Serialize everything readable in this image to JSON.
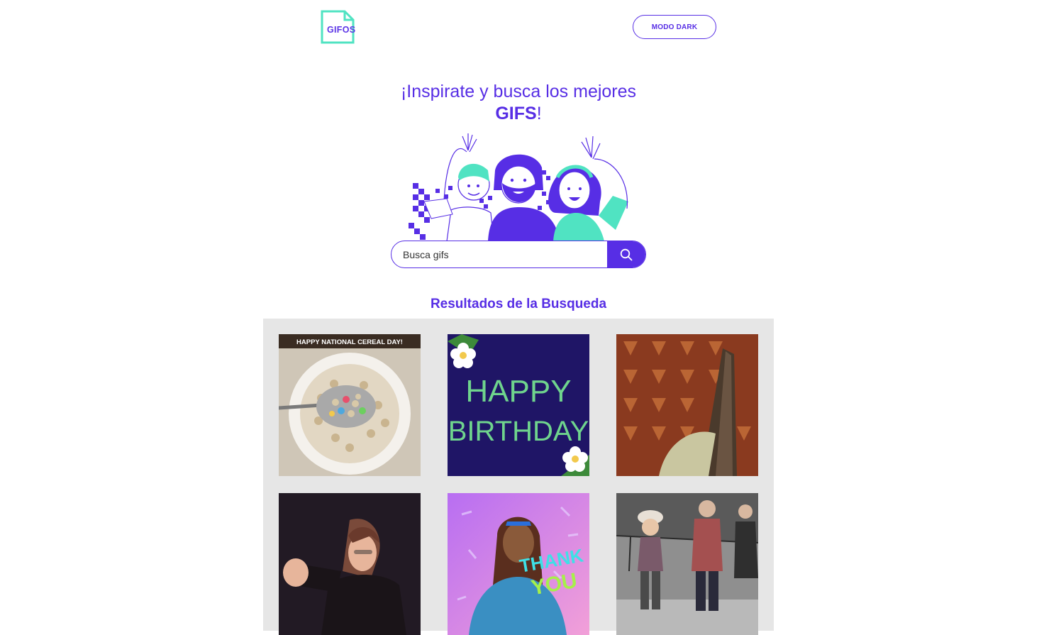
{
  "logo": {
    "text": "GIFOS"
  },
  "header": {
    "mode_button": "MODO DARK"
  },
  "hero": {
    "title_line1": "¡Inspirate y busca los mejores",
    "title_bold": "GIFS",
    "title_end": "!"
  },
  "search": {
    "value": "Busca gifs",
    "button_icon": "search-icon"
  },
  "results": {
    "title": "Resultados de la Busqueda",
    "items": [
      {
        "name": "gif-cereal",
        "caption": "HAPPY NATIONAL CEREAL DAY!"
      },
      {
        "name": "gif-happy-birthday",
        "line1": "HAPPY",
        "line2": "BIRTHDAY"
      },
      {
        "name": "gif-door"
      },
      {
        "name": "gif-dancing-woman"
      },
      {
        "name": "gif-thank-you",
        "line1": "THANK",
        "line2": "YOU"
      },
      {
        "name": "gif-kid-dancing"
      }
    ]
  },
  "colors": {
    "accent": "#572ee5",
    "teal": "#50e3c2",
    "panel": "#e6e6e6"
  }
}
